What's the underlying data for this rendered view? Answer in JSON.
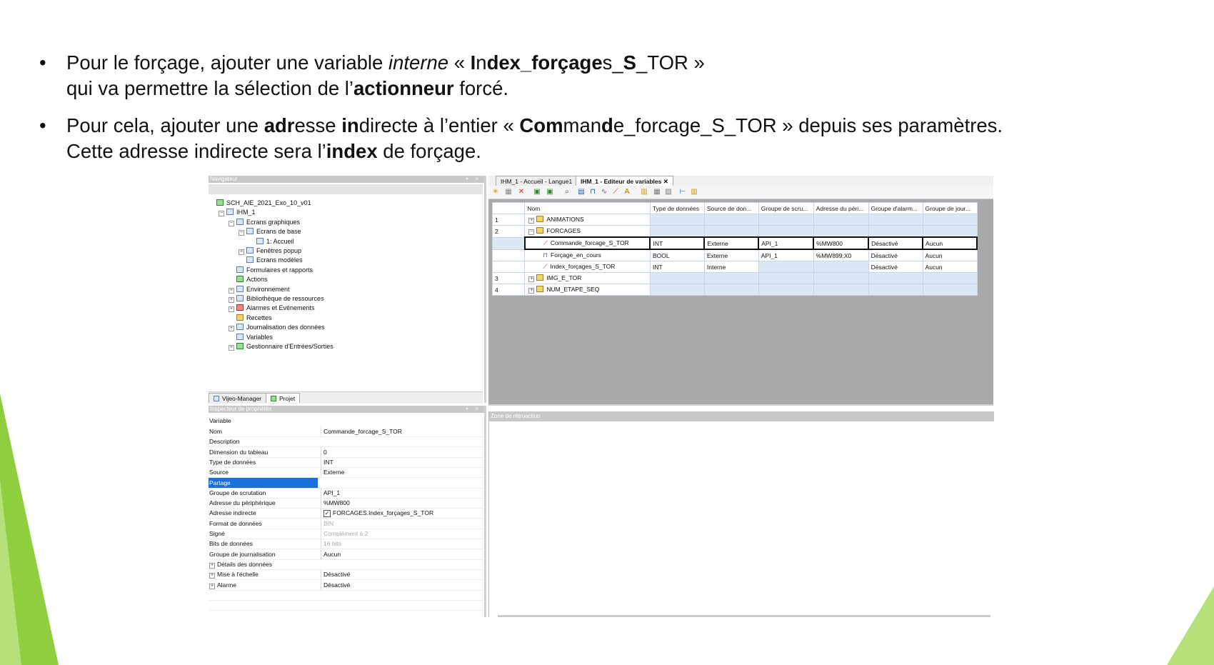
{
  "slide": {
    "bullet1": {
      "line1": [
        {
          "t": "Pour le forçage, ajouter une variable ",
          "s": ""
        },
        {
          "t": "interne",
          "s": "i"
        },
        {
          "t": " « ",
          "s": ""
        },
        {
          "t": "I",
          "s": "b"
        },
        {
          "t": "n",
          "s": ""
        },
        {
          "t": "dex_forçage",
          "s": "b"
        },
        {
          "t": "s_",
          "s": ""
        },
        {
          "t": "S",
          "s": "b"
        },
        {
          "t": "_TOR »",
          "s": ""
        }
      ],
      "line2": [
        {
          "t": "qui va permettre la sélection de l’",
          "s": ""
        },
        {
          "t": "actionneur",
          "s": "b"
        },
        {
          "t": " forcé.",
          "s": ""
        }
      ]
    },
    "bullet2": {
      "line1": [
        {
          "t": "Pour cela, ajouter une ",
          "s": ""
        },
        {
          "t": "adr",
          "s": "b"
        },
        {
          "t": "esse ",
          "s": ""
        },
        {
          "t": "in",
          "s": "b"
        },
        {
          "t": "directe à l’entier « ",
          "s": ""
        },
        {
          "t": "C",
          "s": "b"
        },
        {
          "t": "om",
          "s": "b"
        },
        {
          "t": "man",
          "s": ""
        },
        {
          "t": "d",
          "s": "b"
        },
        {
          "t": "e_forcage_S_TOR » depuis ses paramètres.",
          "s": ""
        }
      ],
      "line2": [
        {
          "t": "Cette adresse indirecte sera l’",
          "s": ""
        },
        {
          "t": "ind",
          "s": "b"
        },
        {
          "t": "ex",
          "s": "b"
        },
        {
          "t": " de forçage.",
          "s": ""
        }
      ]
    },
    "bullet_symbol": "•",
    "colors": {
      "accent_green": "#8fce3f",
      "accent_light": "#b5e07a",
      "selection_blue": "#1a6fd8",
      "grid_blue": "#dde8f7"
    }
  },
  "project_tree": {
    "title": "Navigateur",
    "items": [
      {
        "label": "SCH_AIE_2021_Exo_10_v01",
        "icon": "project-icon",
        "exp": "",
        "level": 0
      },
      {
        "label": "IHM_1",
        "icon": "hmi-icon",
        "exp": "−",
        "level": 1
      },
      {
        "label": "Ecrans graphiques",
        "icon": "screens-icon",
        "exp": "−",
        "level": 2
      },
      {
        "label": "Ecrans de base",
        "icon": "screens-icon",
        "exp": "−",
        "level": 3
      },
      {
        "label": "1: Accueil",
        "icon": "screen-icon",
        "exp": "",
        "level": 4
      },
      {
        "label": "Fenêtres popup",
        "icon": "popup-icon",
        "exp": "+",
        "level": 3
      },
      {
        "label": "Ecrans modèles",
        "icon": "template-icon",
        "exp": "",
        "level": 3
      },
      {
        "label": "Formulaires et rapports",
        "icon": "forms-icon",
        "exp": "",
        "level": 2
      },
      {
        "label": "Actions",
        "icon": "actions-icon",
        "exp": "",
        "level": 2
      },
      {
        "label": "Environnement",
        "icon": "environment-icon",
        "exp": "+",
        "level": 2
      },
      {
        "label": "Bibliothèque de ressources",
        "icon": "library-icon",
        "exp": "+",
        "level": 2
      },
      {
        "label": "Alarmes et Evénements",
        "icon": "alarm-icon",
        "exp": "+",
        "level": 2
      },
      {
        "label": "Recettes",
        "icon": "recipe-icon",
        "exp": "",
        "level": 2
      },
      {
        "label": "Journalisation des données",
        "icon": "logging-icon",
        "exp": "+",
        "level": 2
      },
      {
        "label": "Variables",
        "icon": "variables-icon",
        "exp": "",
        "level": 2
      },
      {
        "label": "Gestionnaire d'Entrées/Sorties",
        "icon": "io-icon",
        "exp": "+",
        "level": 2
      }
    ],
    "bottom_tabs": [
      "Vijeo-Manager",
      "Projet"
    ]
  },
  "editor": {
    "tabs": [
      "IHM_1 - Accueil - Langue1",
      "IHM_1 - Editeur de variables"
    ],
    "columns": [
      "Nom",
      "Type de données",
      "Source de don...",
      "Groupe de scru...",
      "Adresse du péri...",
      "Groupe d'alarm...",
      "Groupe de jour..."
    ],
    "rows": [
      {
        "num": "1",
        "name": "ANIMATIONS",
        "kind": "group",
        "exp": "+",
        "cells": [
          "",
          "",
          "",
          "",
          "",
          ""
        ]
      },
      {
        "num": "2",
        "name": "FORCAGES",
        "kind": "group",
        "exp": "−",
        "cells": [
          "",
          "",
          "",
          "",
          "",
          ""
        ]
      },
      {
        "num": "",
        "name": "Commande_forcage_S_TOR",
        "kind": "int",
        "exp": "",
        "selected": true,
        "cells": [
          "INT",
          "Externe",
          "API_1",
          "%MW800",
          "Désactivé",
          "Aucun"
        ]
      },
      {
        "num": "",
        "name": "Forçage_en_cours",
        "kind": "bool",
        "exp": "",
        "cells": [
          "BOOL",
          "Externe",
          "API_1",
          "%MW899:X0",
          "Désactivé",
          "Aucun"
        ]
      },
      {
        "num": "",
        "name": "Index_forçages_S_TOR",
        "kind": "int",
        "exp": "",
        "cells": [
          "INT",
          "Interne",
          "",
          "",
          "Désactivé",
          "Aucun"
        ]
      },
      {
        "num": "3",
        "name": "IMG_E_TOR",
        "kind": "group",
        "exp": "+",
        "cells": [
          "",
          "",
          "",
          "",
          "",
          ""
        ]
      },
      {
        "num": "4",
        "name": "NUM_ETAPE_SEQ",
        "kind": "group",
        "exp": "+",
        "cells": [
          "",
          "",
          "",
          "",
          "",
          ""
        ]
      }
    ],
    "feedback_title": "Zone de rétroaction"
  },
  "inspector": {
    "title": "Inspecteur de propriétés",
    "header": "Variable",
    "rows": [
      {
        "k": "Nom",
        "v": "Commande_forcage_S_TOR"
      },
      {
        "k": "Description",
        "v": ""
      },
      {
        "k": "Dimension du tableau",
        "v": "0"
      },
      {
        "k": "Type de données",
        "v": "INT"
      },
      {
        "k": "Source",
        "v": "Externe"
      },
      {
        "k": "Partage",
        "v": "",
        "hl": true
      },
      {
        "k": "Groupe de scrutation",
        "v": "API_1"
      },
      {
        "k": "Adresse du périphérique",
        "v": "%MW800"
      },
      {
        "k": "Adresse indirecte",
        "v": "FORCAGES.Index_forçages_S_TOR",
        "check": true
      },
      {
        "k": "Format de données",
        "v": "BIN",
        "muted": true
      },
      {
        "k": "Signé",
        "v": "Complément à 2",
        "muted": true
      },
      {
        "k": "Bits de données",
        "v": "16 bits",
        "muted": true
      },
      {
        "k": "Groupe de journalisation",
        "v": "Aucun"
      },
      {
        "k": "Détails des données",
        "v": "",
        "exp": "+"
      },
      {
        "k": "Mise à l'échelle",
        "v": "Désactivé",
        "exp": "+"
      },
      {
        "k": "Alarme",
        "v": "Désactivé",
        "exp": "+"
      }
    ]
  }
}
